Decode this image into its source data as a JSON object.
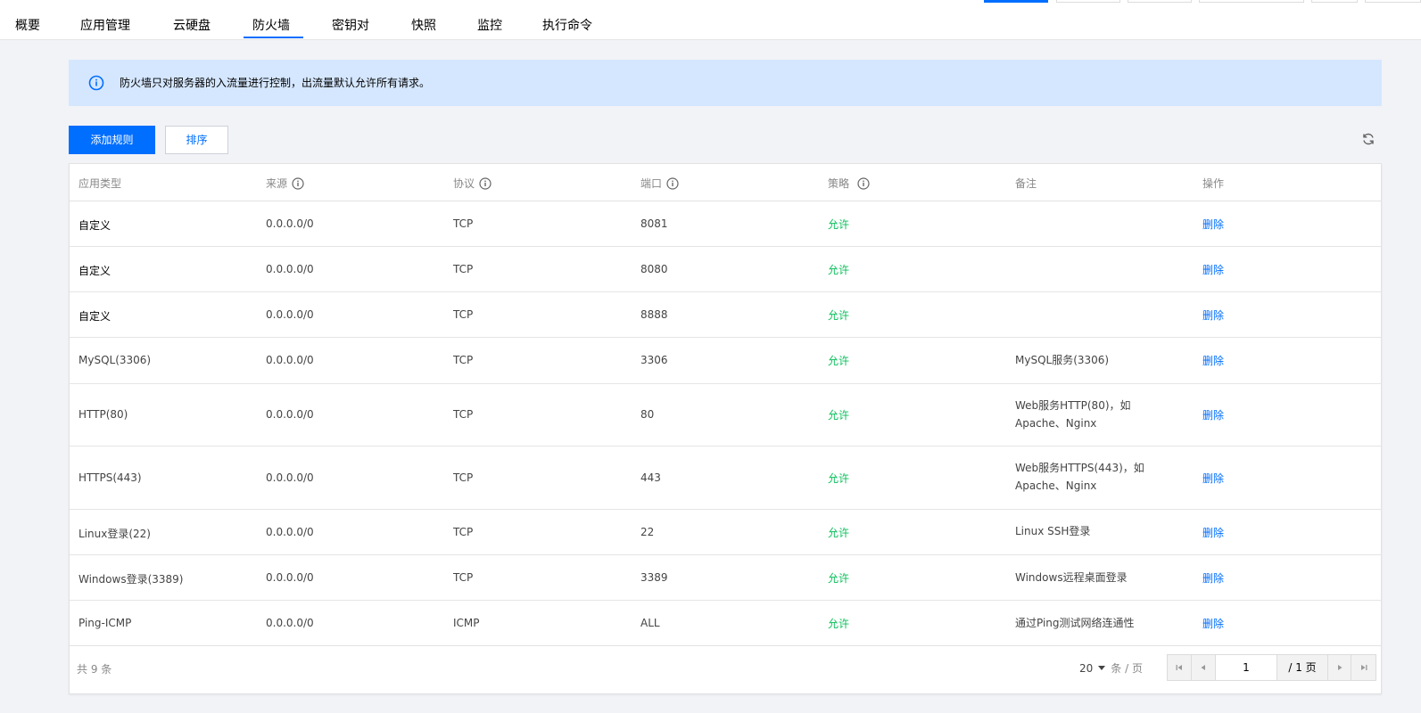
{
  "tabs": [
    {
      "label": "概要",
      "active": false
    },
    {
      "label": "应用管理",
      "active": false
    },
    {
      "label": "云硬盘",
      "active": false
    },
    {
      "label": "防火墙",
      "active": true
    },
    {
      "label": "密钥对",
      "active": false
    },
    {
      "label": "快照",
      "active": false
    },
    {
      "label": "监控",
      "active": false
    },
    {
      "label": "执行命令",
      "active": false
    }
  ],
  "alert": {
    "icon": "info-icon",
    "text": "防火墙只对服务器的入流量进行控制，出流量默认允许所有请求。"
  },
  "toolbar": {
    "add_rule_label": "添加规则",
    "sort_label": "排序",
    "refresh_icon": "refresh-icon"
  },
  "table": {
    "columns": [
      {
        "label": "应用类型",
        "tip": false
      },
      {
        "label": "来源",
        "tip": true
      },
      {
        "label": "协议",
        "tip": true
      },
      {
        "label": "端口",
        "tip": true
      },
      {
        "label": "策略",
        "tip": true
      },
      {
        "label": "备注",
        "tip": false
      },
      {
        "label": "操作",
        "tip": false
      }
    ],
    "rows": [
      {
        "type": "自定义",
        "source": "0.0.0.0/0",
        "protocol": "TCP",
        "port": "8081",
        "policy": "允许",
        "remark": "",
        "action": "删除"
      },
      {
        "type": "自定义",
        "source": "0.0.0.0/0",
        "protocol": "TCP",
        "port": "8080",
        "policy": "允许",
        "remark": "",
        "action": "删除"
      },
      {
        "type": "自定义",
        "source": "0.0.0.0/0",
        "protocol": "TCP",
        "port": "8888",
        "policy": "允许",
        "remark": "",
        "action": "删除"
      },
      {
        "type": "MySQL(3306)",
        "source": "0.0.0.0/0",
        "protocol": "TCP",
        "port": "3306",
        "policy": "允许",
        "remark": "MySQL服务(3306)",
        "action": "删除"
      },
      {
        "type": "HTTP(80)",
        "source": "0.0.0.0/0",
        "protocol": "TCP",
        "port": "80",
        "policy": "允许",
        "remark": "Web服务HTTP(80)，如Apache、Nginx",
        "action": "删除"
      },
      {
        "type": "HTTPS(443)",
        "source": "0.0.0.0/0",
        "protocol": "TCP",
        "port": "443",
        "policy": "允许",
        "remark": "Web服务HTTPS(443)，如Apache、Nginx",
        "action": "删除"
      },
      {
        "type": "Linux登录(22)",
        "source": "0.0.0.0/0",
        "protocol": "TCP",
        "port": "22",
        "policy": "允许",
        "remark": "Linux SSH登录",
        "action": "删除"
      },
      {
        "type": "Windows登录(3389)",
        "source": "0.0.0.0/0",
        "protocol": "TCP",
        "port": "3389",
        "policy": "允许",
        "remark": "Windows远程桌面登录",
        "action": "删除"
      },
      {
        "type": "Ping-ICMP",
        "source": "0.0.0.0/0",
        "protocol": "ICMP",
        "port": "ALL",
        "policy": "允许",
        "remark": "通过Ping测试网络连通性",
        "action": "删除"
      }
    ]
  },
  "footer": {
    "total_text": "共 9 条",
    "page_size": "20",
    "page_size_unit": "条 / 页",
    "current_page": "1",
    "total_pages_text": "/ 1 页"
  },
  "colors": {
    "primary": "#006eff",
    "allow": "#0abf5b",
    "alert_bg": "#d5e7ff"
  }
}
